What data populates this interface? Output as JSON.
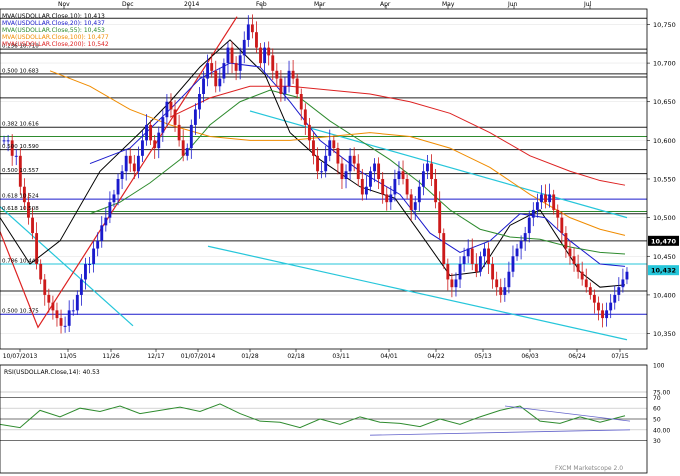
{
  "chart_data": {
    "type": "candlestick",
    "instrument": "USDOLLAR",
    "watermark": "FXCM Marketscope 2.0",
    "top_months": [
      "Nov",
      "Dec",
      "2014",
      "Feb",
      "Mar",
      "Apr",
      "May",
      "Jun",
      "Jul"
    ],
    "bottom_dates": [
      "10/07/2013",
      "11/05",
      "11/26",
      "12/17",
      "01/07/2014",
      "01/28",
      "02/18",
      "03/11",
      "04/01",
      "04/22",
      "05/13",
      "06/03",
      "06/24",
      "07/15"
    ],
    "price_ylim": [
      10330,
      10770
    ],
    "price_ticks": [
      10750,
      10700,
      10650,
      10600,
      10550,
      10500,
      10450,
      10400,
      10350
    ],
    "price_tick_labels": [
      "10,750",
      "10,700",
      "10,650",
      "10,600",
      "10,550",
      "10,500",
      "10,450",
      "10,400",
      "10,350"
    ],
    "price_tags": [
      {
        "label": "10,470",
        "value": 10470,
        "color": "#000000",
        "text_color": "#ffffff"
      },
      {
        "label": "10,432",
        "value": 10432,
        "color": "#26c6da",
        "text_color": "#000000"
      }
    ],
    "legend": [
      {
        "text": "MVA(USDOLLAR.Close,10): 10,413",
        "color": "#000000"
      },
      {
        "text": "MVA(USDOLLAR.Close,20): 10,437",
        "color": "#1a1acc"
      },
      {
        "text": "MVA(USDOLLAR.Close,55): 10,453",
        "color": "#2e8b2e"
      },
      {
        "text": "MVA(USDOLLAR.Close,100): 10,477",
        "color": "#f08c00"
      },
      {
        "text": "MVA(USDOLLAR.Close,200): 10,542",
        "color": "#dd2222"
      }
    ],
    "fib_levels": [
      {
        "value": 10758,
        "label": "",
        "color": "#222222"
      },
      {
        "value": 10718,
        "label": "0.236 10.710",
        "color": "#222222"
      },
      {
        "value": 10713,
        "label": "",
        "color": "#222222"
      },
      {
        "value": 10686,
        "label": "0.500 10.683",
        "color": "#222222"
      },
      {
        "value": 10682,
        "label": "",
        "color": "#222222"
      },
      {
        "value": 10655,
        "label": "",
        "color": "#222222"
      },
      {
        "value": 10617,
        "label": "0.382 10.616",
        "color": "#222222"
      },
      {
        "value": 10605,
        "label": "",
        "color": "#2e8b2e"
      },
      {
        "value": 10588,
        "label": "0.500 10.590",
        "color": "#222222"
      },
      {
        "value": 10557,
        "label": "0.500 10.557",
        "color": "#222222"
      },
      {
        "value": 10524,
        "label": "0.618 10.524",
        "color": "#1a1acc"
      },
      {
        "value": 10508,
        "label": "0.618 10.508",
        "color": "#2e8b2e"
      },
      {
        "value": 10505,
        "label": "",
        "color": "#222222"
      },
      {
        "value": 10470,
        "label": "",
        "color": "#222222"
      },
      {
        "value": 10440,
        "label": "0.786 10.440",
        "color": "#26c6da"
      },
      {
        "value": 10405,
        "label": "",
        "color": "#222222"
      },
      {
        "value": 10375,
        "label": "0.500 10.375",
        "color": "#1a1acc"
      }
    ],
    "trendlines": [
      {
        "points": [
          [
            -5,
            10520
          ],
          [
            133,
            10360
          ]
        ],
        "color": "#26c6da"
      },
      {
        "points": [
          [
            250,
            10638
          ],
          [
            627,
            10500
          ]
        ],
        "color": "#26c6da"
      },
      {
        "points": [
          [
            208,
            10463
          ],
          [
            627,
            10342
          ]
        ],
        "color": "#26c6da"
      },
      {
        "points": [
          [
            0,
            10482
          ],
          [
            38,
            10358
          ],
          [
            237,
            10760
          ]
        ],
        "color": "#dd2222"
      }
    ],
    "ohlc_closes": [
      10.6,
      10.6,
      10.58,
      10.58,
      10.54,
      10.52,
      10.5,
      10.48,
      10.44,
      10.42,
      10.4,
      10.39,
      10.38,
      10.37,
      10.36,
      10.36,
      10.38,
      10.38,
      10.4,
      10.42,
      10.44,
      10.44,
      10.46,
      10.47,
      10.49,
      10.5,
      10.52,
      10.53,
      10.55,
      10.56,
      10.58,
      10.57,
      10.56,
      10.58,
      10.6,
      10.62,
      10.6,
      10.59,
      10.61,
      10.63,
      10.65,
      10.64,
      10.62,
      10.6,
      10.58,
      10.59,
      10.62,
      10.64,
      10.66,
      10.68,
      10.7,
      10.69,
      10.67,
      10.68,
      10.7,
      10.72,
      10.7,
      10.69,
      10.71,
      10.73,
      10.75,
      10.74,
      10.72,
      10.7,
      10.72,
      10.71,
      10.69,
      10.68,
      10.66,
      10.67,
      10.69,
      10.68,
      10.66,
      10.64,
      10.62,
      10.6,
      10.58,
      10.56,
      10.56,
      10.58,
      10.6,
      10.59,
      10.57,
      10.55,
      10.56,
      10.58,
      10.57,
      10.55,
      10.53,
      10.54,
      10.56,
      10.57,
      10.55,
      10.53,
      10.52,
      10.53,
      10.55,
      10.56,
      10.55,
      10.53,
      10.51,
      10.52,
      10.54,
      10.56,
      10.57,
      10.55,
      10.52,
      10.48,
      10.44,
      10.42,
      10.41,
      10.42,
      10.44,
      10.45,
      10.46,
      10.44,
      10.43,
      10.45,
      10.46,
      10.44,
      10.42,
      10.41,
      10.4,
      10.41,
      10.43,
      10.45,
      10.46,
      10.47,
      10.48,
      10.5,
      10.51,
      10.52,
      10.53,
      10.52,
      10.53,
      10.51,
      10.5,
      10.48,
      10.46,
      10.45,
      10.44,
      10.43,
      10.42,
      10.41,
      10.4,
      10.39,
      10.38,
      10.37,
      10.38,
      10.39,
      10.4,
      10.41,
      10.42,
      10.43
    ],
    "mva_series": [
      {
        "name": "MVA 10",
        "color": "#000000",
        "x": [
          0,
          30,
          60,
          100,
          140,
          170,
          200,
          230,
          265,
          290,
          320,
          360,
          395,
          420,
          450,
          480,
          510,
          540,
          560,
          580,
          600,
          625
        ],
        "y": [
          10500,
          10440,
          10470,
          10560,
          10610,
          10650,
          10695,
          10730,
          10685,
          10610,
          10575,
          10540,
          10525,
          10480,
          10425,
          10430,
          10490,
          10510,
          10470,
          10430,
          10410,
          10413
        ]
      },
      {
        "name": "MVA 20",
        "color": "#1a1acc",
        "x": [
          90,
          130,
          170,
          200,
          230,
          260,
          290,
          320,
          360,
          400,
          430,
          460,
          490,
          520,
          545,
          570,
          600,
          625
        ],
        "y": [
          10570,
          10590,
          10640,
          10680,
          10700,
          10695,
          10650,
          10600,
          10560,
          10530,
          10480,
          10455,
          10470,
          10505,
          10500,
          10470,
          10440,
          10437
        ]
      },
      {
        "name": "MVA 55",
        "color": "#2e8b2e",
        "x": [
          90,
          120,
          150,
          180,
          210,
          240,
          270,
          300,
          330,
          360,
          390,
          420,
          450,
          480,
          510,
          540,
          570,
          600,
          625
        ],
        "y": [
          10505,
          10520,
          10545,
          10575,
          10620,
          10650,
          10665,
          10655,
          10625,
          10600,
          10575,
          10545,
          10510,
          10485,
          10475,
          10472,
          10462,
          10455,
          10453
        ]
      },
      {
        "name": "MVA 100",
        "color": "#f08c00",
        "x": [
          50,
          90,
          130,
          170,
          210,
          250,
          290,
          330,
          370,
          410,
          450,
          490,
          530,
          570,
          600,
          625
        ],
        "y": [
          10690,
          10670,
          10640,
          10620,
          10605,
          10600,
          10600,
          10605,
          10610,
          10605,
          10590,
          10565,
          10530,
          10500,
          10485,
          10477
        ]
      },
      {
        "name": "MVA 200",
        "color": "#dd2222",
        "x": [
          170,
          210,
          250,
          290,
          330,
          370,
          410,
          450,
          490,
          530,
          570,
          600,
          625
        ],
        "y": [
          10630,
          10655,
          10670,
          10670,
          10665,
          10660,
          10650,
          10635,
          10610,
          10580,
          10560,
          10548,
          10542
        ]
      }
    ],
    "rsi": {
      "title": "RSI(USDOLLAR.Close,14): 40.53",
      "ylim": [
        0,
        100
      ],
      "ticks": [
        100,
        75,
        70,
        60,
        50,
        40,
        30
      ],
      "tick_labels": [
        "100",
        "75.00",
        "70",
        "60",
        "50",
        "40.00",
        "30"
      ],
      "x": [
        0,
        20,
        40,
        60,
        80,
        100,
        120,
        140,
        160,
        180,
        200,
        220,
        240,
        260,
        280,
        300,
        320,
        340,
        360,
        380,
        400,
        420,
        440,
        460,
        480,
        500,
        520,
        540,
        560,
        580,
        600,
        625
      ],
      "values": [
        45,
        42,
        58,
        52,
        60,
        57,
        62,
        55,
        58,
        61,
        57,
        64,
        55,
        48,
        47,
        42,
        50,
        45,
        52,
        47,
        46,
        43,
        50,
        45,
        52,
        58,
        62,
        48,
        46,
        52,
        47,
        53
      ]
    }
  }
}
